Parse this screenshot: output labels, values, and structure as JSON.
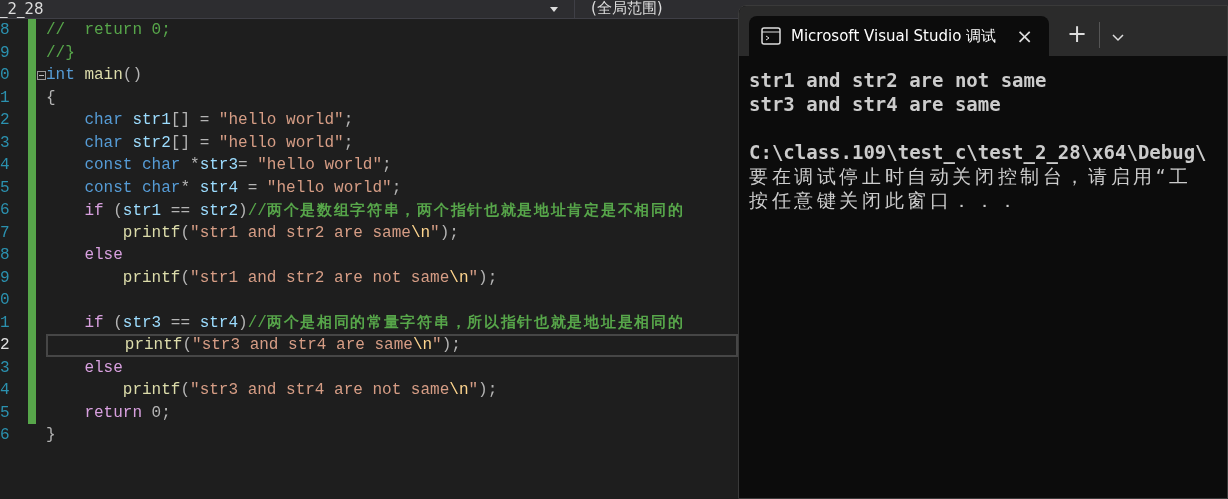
{
  "top_bar": {
    "file_combo": "_2_28",
    "scope_combo": "(全局范围)"
  },
  "editor": {
    "lines": [
      {
        "number": "8",
        "current": false,
        "tokens": [
          {
            "t": "//  return 0;",
            "kind": "comment"
          }
        ]
      },
      {
        "number": "9",
        "current": false,
        "tokens": [
          {
            "t": "//}",
            "kind": "comment"
          }
        ]
      },
      {
        "number": "0",
        "current": false,
        "foldable": true,
        "tokens": [
          {
            "t": "int",
            "kind": "keyword"
          },
          {
            "t": " main",
            "kind": "function"
          },
          {
            "t": "()",
            "kind": "plain"
          }
        ]
      },
      {
        "number": "1",
        "current": false,
        "tokens": [
          {
            "t": "{",
            "kind": "plain"
          }
        ]
      },
      {
        "number": "2",
        "current": false,
        "tokens": [
          {
            "t": "    char",
            "kind": "keyword"
          },
          {
            "t": " str1",
            "kind": "ident"
          },
          {
            "t": "[] =",
            "kind": "plain"
          },
          {
            "t": " \"hello world\"",
            "kind": "string"
          },
          {
            "t": ";",
            "kind": "plain"
          }
        ]
      },
      {
        "number": "3",
        "current": false,
        "tokens": [
          {
            "t": "    char",
            "kind": "keyword"
          },
          {
            "t": " str2",
            "kind": "ident"
          },
          {
            "t": "[] =",
            "kind": "plain"
          },
          {
            "t": " \"hello world\"",
            "kind": "string"
          },
          {
            "t": ";",
            "kind": "plain"
          }
        ]
      },
      {
        "number": "4",
        "current": false,
        "tokens": [
          {
            "t": "    const char",
            "kind": "keyword"
          },
          {
            "t": " *",
            "kind": "plain"
          },
          {
            "t": "str3",
            "kind": "ident"
          },
          {
            "t": "=",
            "kind": "plain"
          },
          {
            "t": " \"hello world\"",
            "kind": "string"
          },
          {
            "t": ";",
            "kind": "plain"
          }
        ]
      },
      {
        "number": "5",
        "current": false,
        "tokens": [
          {
            "t": "    const char",
            "kind": "keyword"
          },
          {
            "t": "*",
            "kind": "plain"
          },
          {
            "t": " str4",
            "kind": "ident"
          },
          {
            "t": " =",
            "kind": "plain"
          },
          {
            "t": " \"hello world\"",
            "kind": "string"
          },
          {
            "t": ";",
            "kind": "plain"
          }
        ]
      },
      {
        "number": "6",
        "current": false,
        "tokens": [
          {
            "t": "    if",
            "kind": "control"
          },
          {
            "t": " (",
            "kind": "plain"
          },
          {
            "t": "str1",
            "kind": "ident"
          },
          {
            "t": " ==",
            "kind": "plain"
          },
          {
            "t": " str2",
            "kind": "ident"
          },
          {
            "t": ")",
            "kind": "plain"
          },
          {
            "t": "//",
            "kind": "comment"
          },
          {
            "t": "两个是数组字符串，两个指针也就是地址肯定是不相同的",
            "kind": "comment_cjk"
          }
        ]
      },
      {
        "number": "7",
        "current": false,
        "tokens": [
          {
            "t": "        printf",
            "kind": "function"
          },
          {
            "t": "(",
            "kind": "plain"
          },
          {
            "t": "\"str1 and str2 are same",
            "kind": "string"
          },
          {
            "t": "\\n",
            "kind": "escape"
          },
          {
            "t": "\"",
            "kind": "string"
          },
          {
            "t": ");",
            "kind": "plain"
          }
        ]
      },
      {
        "number": "8",
        "current": false,
        "tokens": [
          {
            "t": "    else",
            "kind": "control"
          }
        ]
      },
      {
        "number": "9",
        "current": false,
        "tokens": [
          {
            "t": "        printf",
            "kind": "function"
          },
          {
            "t": "(",
            "kind": "plain"
          },
          {
            "t": "\"str1 and str2 are not same",
            "kind": "string"
          },
          {
            "t": "\\n",
            "kind": "escape"
          },
          {
            "t": "\"",
            "kind": "string"
          },
          {
            "t": ");",
            "kind": "plain"
          }
        ]
      },
      {
        "number": "0",
        "current": false
      },
      {
        "number": "1",
        "current": false,
        "tokens": [
          {
            "t": "    if",
            "kind": "control"
          },
          {
            "t": " (",
            "kind": "plain"
          },
          {
            "t": "str3",
            "kind": "ident"
          },
          {
            "t": " ==",
            "kind": "plain"
          },
          {
            "t": " str4",
            "kind": "ident"
          },
          {
            "t": ")",
            "kind": "plain"
          },
          {
            "t": "//",
            "kind": "comment"
          },
          {
            "t": "两个是相同的常量字符串，所以指针也就是地址是相同的",
            "kind": "comment_cjk"
          }
        ]
      },
      {
        "number": "2",
        "current": true,
        "tokens": [
          {
            "t": "        printf",
            "kind": "function"
          },
          {
            "t": "(",
            "kind": "plain"
          },
          {
            "t": "\"str3 and str4 are same",
            "kind": "string"
          },
          {
            "t": "\\n",
            "kind": "escape"
          },
          {
            "t": "\"",
            "kind": "string"
          },
          {
            "t": ");",
            "kind": "plain"
          }
        ]
      },
      {
        "number": "3",
        "current": false,
        "tokens": [
          {
            "t": "    else",
            "kind": "control"
          }
        ]
      },
      {
        "number": "4",
        "current": false,
        "tokens": [
          {
            "t": "        printf",
            "kind": "function"
          },
          {
            "t": "(",
            "kind": "plain"
          },
          {
            "t": "\"str3 and str4 are not same",
            "kind": "string"
          },
          {
            "t": "\\n",
            "kind": "escape"
          },
          {
            "t": "\"",
            "kind": "string"
          },
          {
            "t": ");",
            "kind": "plain"
          }
        ]
      },
      {
        "number": "5",
        "current": false,
        "tokens": [
          {
            "t": "    return",
            "kind": "control"
          },
          {
            "t": " 0;",
            "kind": "plain"
          }
        ]
      },
      {
        "number": "6",
        "current": false,
        "tokens": [
          {
            "t": "}",
            "kind": "plain"
          }
        ]
      }
    ]
  },
  "terminal": {
    "tab": {
      "title": "Microsoft Visual Studio 调试",
      "selected": true,
      "close": "×"
    },
    "new_tab": "+",
    "lines": [
      {
        "kind": "output",
        "text": "str1 and str2 are not same"
      },
      {
        "kind": "output",
        "text": "str3 and str4 are same"
      },
      {
        "kind": "prompt",
        "text": "C:\\class.109\\test_c\\test_2_28\\x64\\Debug\\"
      },
      {
        "kind": "message",
        "text": "要在调试停止时自动关闭控制台，请启用“工"
      },
      {
        "kind": "message",
        "text": "按任意键关闭此窗口．．．"
      }
    ]
  }
}
